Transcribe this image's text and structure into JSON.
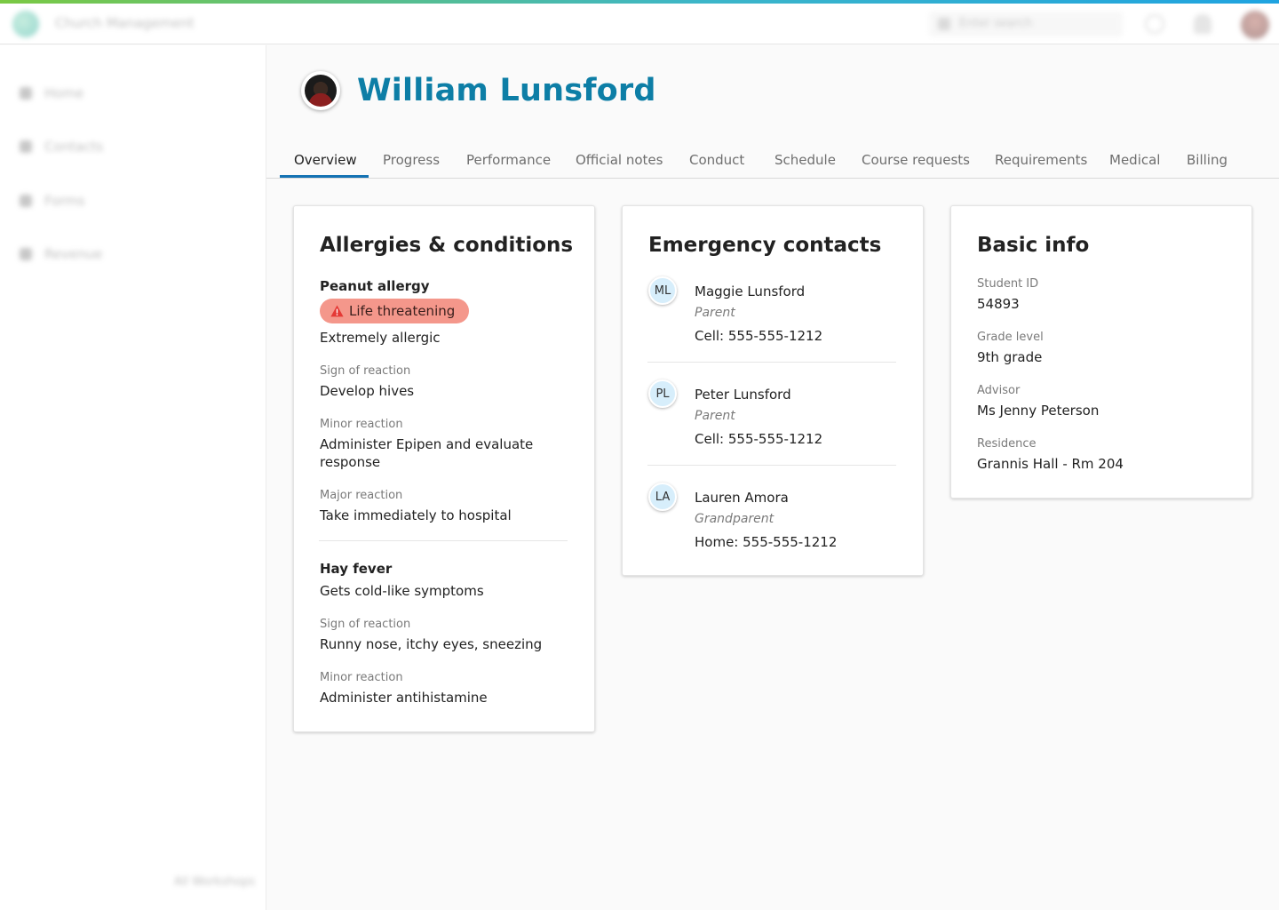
{
  "app": {
    "brand_name": "Church Management",
    "search_placeholder": "Enter search",
    "icons": {
      "help": "help-circle-icon",
      "notifications": "bell-icon",
      "user": "user-avatar"
    }
  },
  "sidebar": {
    "items": [
      {
        "label": "Home",
        "icon": "home-icon"
      },
      {
        "label": "Contacts",
        "icon": "contacts-icon"
      },
      {
        "label": "Forms",
        "icon": "forms-icon"
      },
      {
        "label": "Revenue",
        "icon": "revenue-icon"
      }
    ],
    "footer": "All Workshops"
  },
  "student": {
    "name": "William Lunsford"
  },
  "tabs": [
    {
      "label": "Overview",
      "active": true
    },
    {
      "label": "Progress"
    },
    {
      "label": "Performance"
    },
    {
      "label": "Official notes"
    },
    {
      "label": "Conduct"
    },
    {
      "label": "Schedule"
    },
    {
      "label": "Course requests"
    },
    {
      "label": "Requirements"
    },
    {
      "label": "Medical"
    },
    {
      "label": "Billing"
    }
  ],
  "allergies": {
    "title": "Allergies & conditions",
    "items": [
      {
        "name": "Peanut allergy",
        "badge": "Life threatening",
        "description": "Extremely allergic",
        "sign_label": "Sign of reaction",
        "sign_value": "Develop hives",
        "minor_label": "Minor reaction",
        "minor_value_line1": "Administer Epipen and evaluate",
        "minor_value_line2": "response",
        "major_label": "Major reaction",
        "major_value": "Take immediately to hospital"
      },
      {
        "name": "Hay fever",
        "description": "Gets cold-like symptoms",
        "sign_label": "Sign of reaction",
        "sign_value": "Runny nose, itchy eyes, sneezing",
        "minor_label": "Minor reaction",
        "minor_value": "Administer antihistamine"
      }
    ]
  },
  "emergency": {
    "title": "Emergency contacts",
    "contacts": [
      {
        "initials": "ML",
        "name": "Maggie Lunsford",
        "relation": "Parent",
        "phone": "Cell: 555-555-1212"
      },
      {
        "initials": "PL",
        "name": "Peter Lunsford",
        "relation": "Parent",
        "phone": "Cell: 555-555-1212"
      },
      {
        "initials": "LA",
        "name": "Lauren Amora",
        "relation": "Grandparent",
        "phone": "Home: 555-555-1212"
      }
    ]
  },
  "basic_info": {
    "title": "Basic info",
    "fields": [
      {
        "label": "Student ID",
        "value": "54893"
      },
      {
        "label": "Grade level",
        "value": "9th grade"
      },
      {
        "label": "Advisor",
        "value": "Ms Jenny Peterson"
      },
      {
        "label": "Residence",
        "value": "Grannis Hall - Rm 204"
      }
    ]
  },
  "colors": {
    "accent": "#0d7ea6",
    "tab_indicator": "#1472b3",
    "badge_bg": "#f4978b",
    "warning_icon": "#e53935",
    "avatar_bg": "#d7eefb"
  }
}
